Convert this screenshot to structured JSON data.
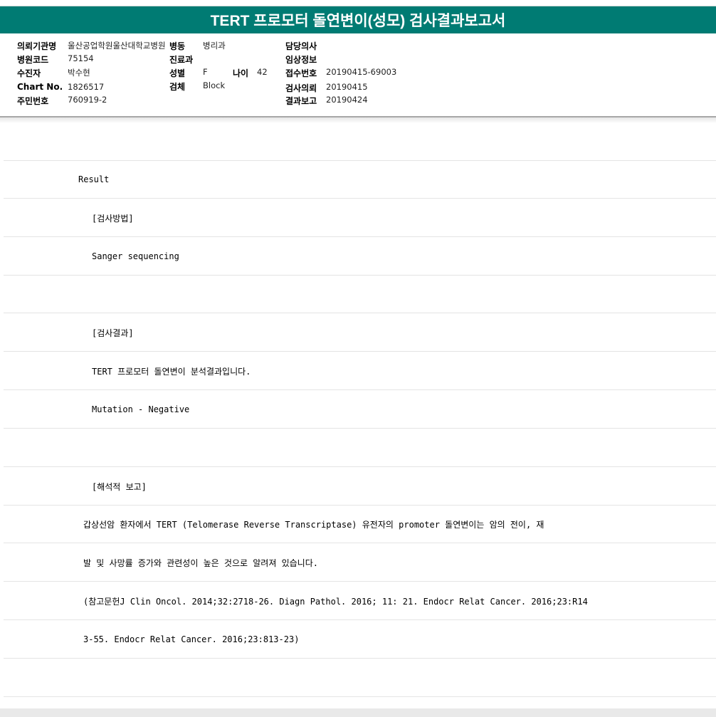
{
  "title": "TERT 프로모터 돌연변이(성모) 검사결과보고서",
  "info": {
    "institution": {
      "label": "의뢰기관명",
      "value": "울산공업학원울산대학교병원"
    },
    "ward": {
      "label": "병동",
      "value": "병리과"
    },
    "doctor": {
      "label": "담당의사",
      "value": ""
    },
    "hospital_code": {
      "label": "병원코드",
      "value": "75154"
    },
    "department": {
      "label": "진료과",
      "value": ""
    },
    "clinical_info": {
      "label": "임상정보",
      "value": ""
    },
    "examinee": {
      "label": "수진자",
      "value": "박수현"
    },
    "sex": {
      "label": "성별",
      "value": "F"
    },
    "age": {
      "label": "나이",
      "value": "42"
    },
    "receipt_no": {
      "label": "접수번호",
      "value": "20190415-69003"
    },
    "chart_no": {
      "label": "Chart No.",
      "value": "1826517"
    },
    "specimen": {
      "label": "검체",
      "value": "Block"
    },
    "request_date": {
      "label": "검사의뢰",
      "value": "20190415"
    },
    "resident_no": {
      "label": "주민번호",
      "value": "760919-2"
    },
    "report_date": {
      "label": "결과보고",
      "value": "20190424"
    }
  },
  "result_lines": [
    "",
    "Result",
    "[검사방법]",
    "Sanger sequencing",
    "",
    "[검사결과]",
    "TERT 프로모터 돌연변이 분석결과입니다.",
    "Mutation - Negative",
    "",
    "[해석적 보고]",
    "갑상선암 환자에서 TERT (Telomerase Reverse Transcriptase) 유전자의 promoter 돌연변이는 암의 전이, 재",
    "발 및 사망률 증가와 관련성이 높은 것으로 알려져 있습니다.",
    "(참고문헌J Clin Oncol. 2014;32:2718-26. Diagn Pathol. 2016; 11: 21. Endocr Relat Cancer. 2016;23:R14",
    "3-55. Endocr Relat Cancer. 2016;23:813-23)",
    ""
  ]
}
